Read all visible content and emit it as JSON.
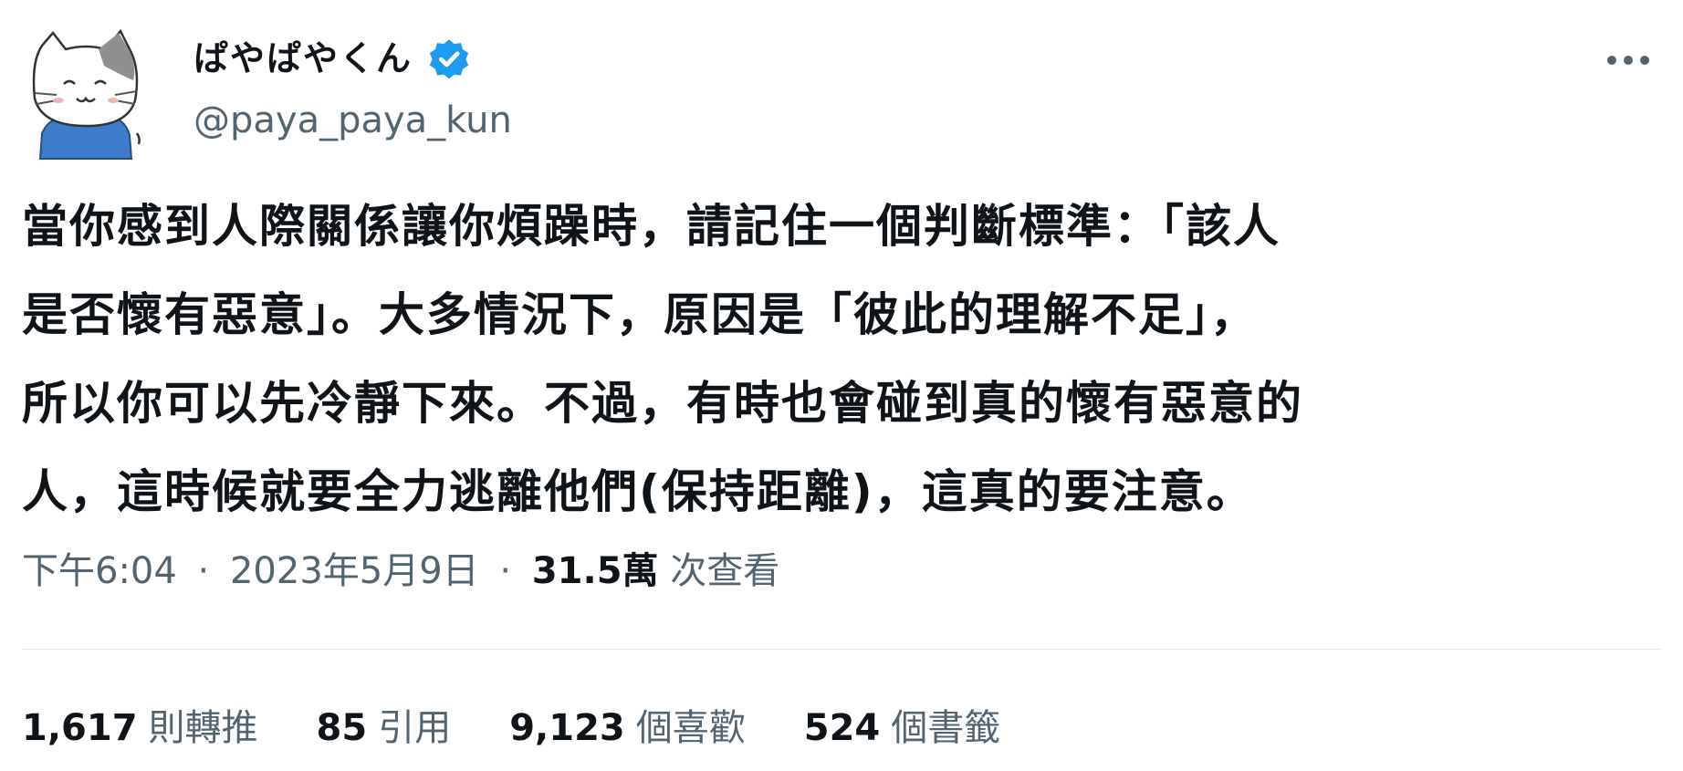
{
  "author": {
    "display_name": "ぱやぱやくん",
    "handle": "@paya_paya_kun",
    "verified_color": "#1d9bf0",
    "avatar_icon": "cat-avatar-icon"
  },
  "tweet": {
    "text": "當你感到人際關係讓你煩躁時，請記住一個判斷標準：「該人\n是否懷有惡意」。大多情況下，原因是「彼此的理解不足」，\n所以你可以先冷靜下來。不過，有時也會碰到真的懷有惡意的\n人，這時候就要全力逃離他們(保持距離)，這真的要注意。"
  },
  "meta": {
    "time": "下午6:04",
    "date": "2023年5月9日",
    "views_count": "31.5萬",
    "views_label": "次查看",
    "separator": "·"
  },
  "stats": {
    "retweets": {
      "count": "1,617",
      "label": "則轉推"
    },
    "quotes": {
      "count": "85",
      "label": "引用"
    },
    "likes": {
      "count": "9,123",
      "label": "個喜歡"
    },
    "bookmarks": {
      "count": "524",
      "label": "個書籤"
    }
  },
  "icons": {
    "more": "more-options-icon",
    "verified": "verified-badge-icon"
  }
}
